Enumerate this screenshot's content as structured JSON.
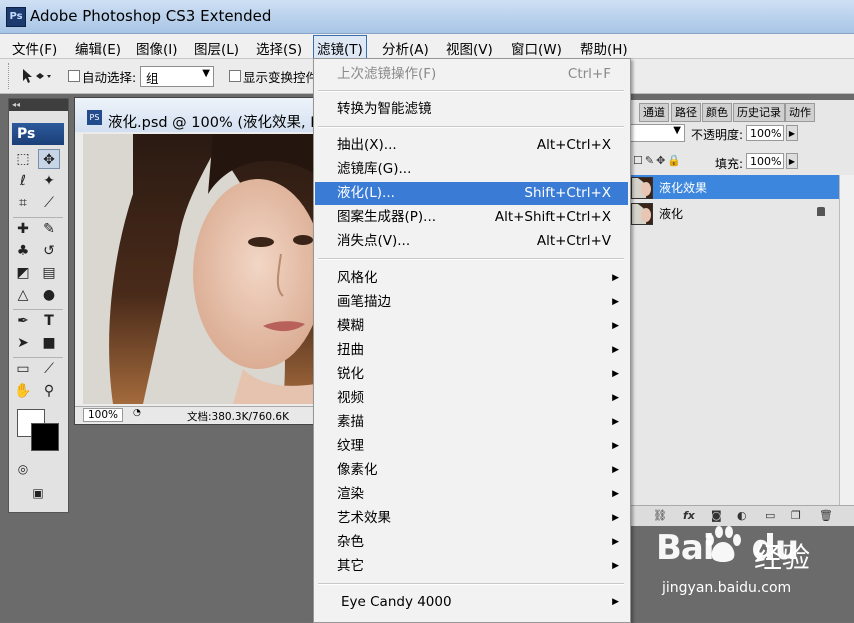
{
  "app": {
    "logo": "Ps",
    "title": "Adobe Photoshop CS3 Extended"
  },
  "menubar": {
    "items": [
      {
        "label": "文件(F)"
      },
      {
        "label": "编辑(E)"
      },
      {
        "label": "图像(I)"
      },
      {
        "label": "图层(L)"
      },
      {
        "label": "选择(S)"
      },
      {
        "label": "滤镜(T)",
        "active": true
      },
      {
        "label": "分析(A)"
      },
      {
        "label": "视图(V)"
      },
      {
        "label": "窗口(W)"
      },
      {
        "label": "帮助(H)"
      }
    ]
  },
  "options": {
    "auto_select_label": "自动选择:",
    "auto_select_value": "组",
    "show_transform_label": "显示变换控件"
  },
  "toolbox": {
    "logo": "Ps"
  },
  "document": {
    "title": "液化.psd @ 100% (液化效果, RGB/8)",
    "zoom": "100%",
    "info": "文档:380.3K/760.6K"
  },
  "layers_panel": {
    "tabs": [
      "通道",
      "路径",
      "颜色",
      "历史记录",
      "动作"
    ],
    "opacity_label": "不透明度:",
    "opacity_value": "100%",
    "fill_label": "填充:",
    "fill_value": "100%",
    "layers": [
      {
        "name": "液化效果",
        "selected": true
      },
      {
        "name": "液化",
        "locked": true
      }
    ]
  },
  "filter_menu": {
    "items": [
      {
        "label": "上次滤镜操作(F)",
        "shortcut": "Ctrl+F",
        "disabled": true
      },
      {
        "label": "转换为智能滤镜"
      },
      {
        "label": "抽出(X)...",
        "shortcut": "Alt+Ctrl+X"
      },
      {
        "label": "滤镜库(G)..."
      },
      {
        "label": "液化(L)...",
        "shortcut": "Shift+Ctrl+X",
        "highlighted": true
      },
      {
        "label": "图案生成器(P)...",
        "shortcut": "Alt+Shift+Ctrl+X"
      },
      {
        "label": "消失点(V)...",
        "shortcut": "Alt+Ctrl+V"
      },
      {
        "label": "风格化",
        "submenu": true
      },
      {
        "label": "画笔描边",
        "submenu": true
      },
      {
        "label": "模糊",
        "submenu": true
      },
      {
        "label": "扭曲",
        "submenu": true
      },
      {
        "label": "锐化",
        "submenu": true
      },
      {
        "label": "视频",
        "submenu": true
      },
      {
        "label": "素描",
        "submenu": true
      },
      {
        "label": "纹理",
        "submenu": true
      },
      {
        "label": "像素化",
        "submenu": true
      },
      {
        "label": "渲染",
        "submenu": true
      },
      {
        "label": "艺术效果",
        "submenu": true
      },
      {
        "label": "杂色",
        "submenu": true
      },
      {
        "label": "其它",
        "submenu": true
      },
      {
        "label": "Eye Candy 4000",
        "submenu": true
      }
    ]
  },
  "watermark": {
    "logo": "Bai",
    "logo2": "du",
    "text": "经验",
    "url": "jingyan.baidu.com"
  }
}
